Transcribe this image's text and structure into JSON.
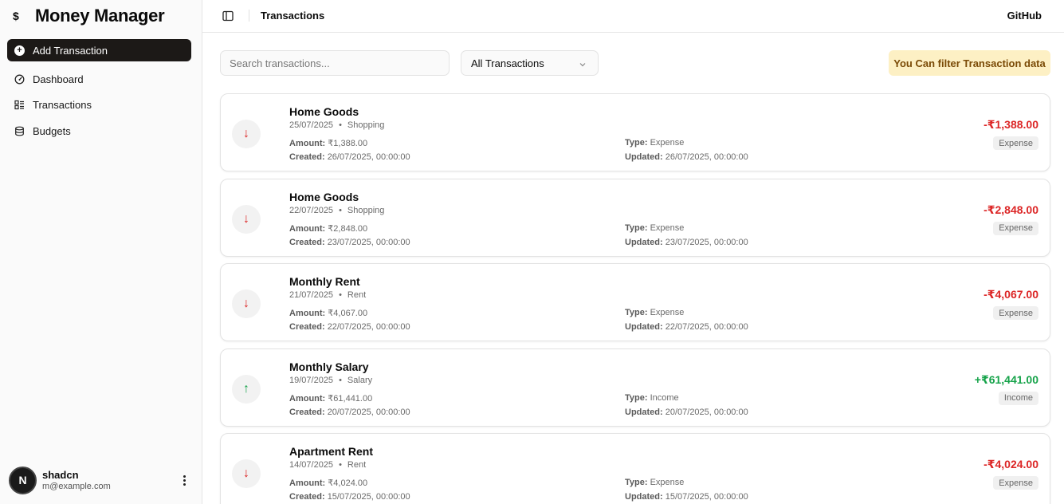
{
  "sidebar": {
    "brand_icon": "$",
    "brand_title": "Money Manager",
    "add_button": "Add Transaction",
    "nav": [
      {
        "label": "Dashboard",
        "icon": "gauge-icon"
      },
      {
        "label": "Transactions",
        "icon": "list-icon"
      },
      {
        "label": "Budgets",
        "icon": "database-icon"
      }
    ],
    "user": {
      "initial": "N",
      "name": "shadcn",
      "email": "m@example.com"
    }
  },
  "header": {
    "title": "Transactions",
    "github": "GitHub"
  },
  "toolbar": {
    "search_placeholder": "Search transactions...",
    "filter_value": "All Transactions",
    "notice": "You Can filter Transaction data"
  },
  "labels": {
    "amount": "Amount:",
    "created": "Created:",
    "type": "Type:",
    "updated": "Updated:"
  },
  "transactions": [
    {
      "title": "Home Goods",
      "date": "25/07/2025",
      "category": "Shopping",
      "amount": "₹1,388.00",
      "created": "26/07/2025, 00:00:00",
      "type": "Expense",
      "updated": "26/07/2025, 00:00:00",
      "display_amount": "-₹1,388.00",
      "badge": "Expense"
    },
    {
      "title": "Home Goods",
      "date": "22/07/2025",
      "category": "Shopping",
      "amount": "₹2,848.00",
      "created": "23/07/2025, 00:00:00",
      "type": "Expense",
      "updated": "23/07/2025, 00:00:00",
      "display_amount": "-₹2,848.00",
      "badge": "Expense"
    },
    {
      "title": "Monthly Rent",
      "date": "21/07/2025",
      "category": "Rent",
      "amount": "₹4,067.00",
      "created": "22/07/2025, 00:00:00",
      "type": "Expense",
      "updated": "22/07/2025, 00:00:00",
      "display_amount": "-₹4,067.00",
      "badge": "Expense"
    },
    {
      "title": "Monthly Salary",
      "date": "19/07/2025",
      "category": "Salary",
      "amount": "₹61,441.00",
      "created": "20/07/2025, 00:00:00",
      "type": "Income",
      "updated": "20/07/2025, 00:00:00",
      "display_amount": "+₹61,441.00",
      "badge": "Income"
    },
    {
      "title": "Apartment Rent",
      "date": "14/07/2025",
      "category": "Rent",
      "amount": "₹4,024.00",
      "created": "15/07/2025, 00:00:00",
      "type": "Expense",
      "updated": "15/07/2025, 00:00:00",
      "display_amount": "-₹4,024.00",
      "badge": "Expense"
    }
  ],
  "colors": {
    "expense": "#dc2626",
    "income": "#16a34a",
    "primary": "#1c1917",
    "notice_bg": "#fdf0c4",
    "notice_text": "#7a4a06"
  },
  "separator": "•"
}
